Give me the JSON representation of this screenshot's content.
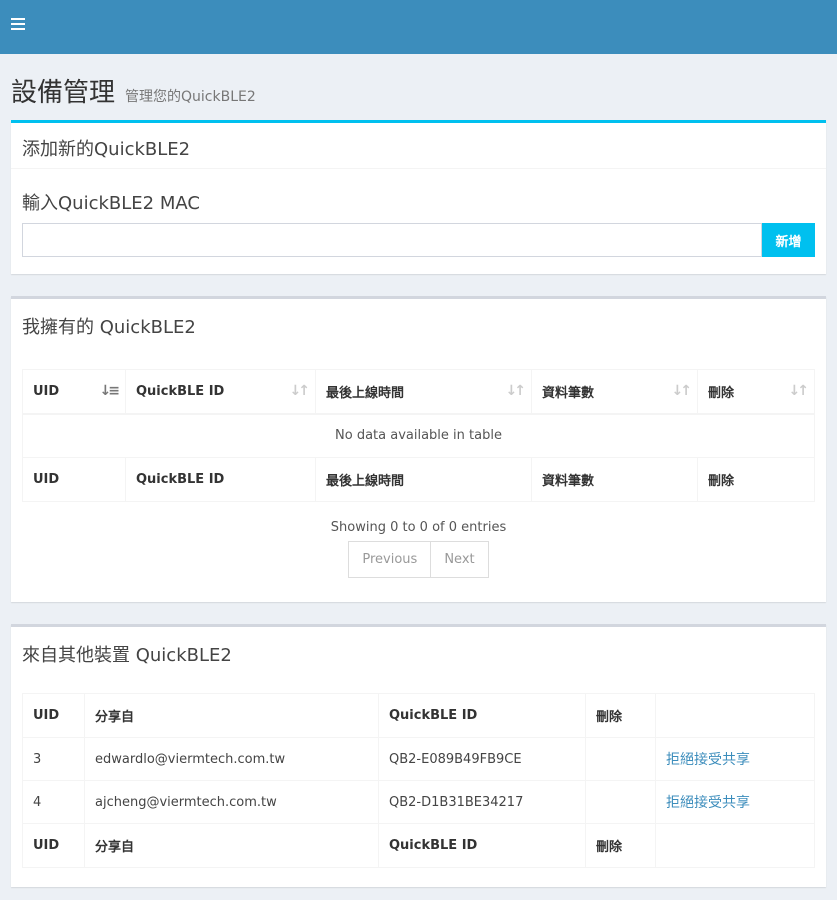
{
  "header": {
    "title": "設備管理",
    "subtitle": "管理您的QuickBLE2"
  },
  "add_box": {
    "title": "添加新的QuickBLE2",
    "label": "輸入QuickBLE2 MAC",
    "input_value": "",
    "button_label": "新增"
  },
  "owned_box": {
    "title": "我擁有的 QuickBLE2",
    "columns": [
      "UID",
      "QuickBLE ID",
      "最後上線時間",
      "資料筆數",
      "刪除"
    ],
    "empty_text": "No data available in table",
    "info_text": "Showing 0 to 0 of 0 entries",
    "pagination": {
      "previous": "Previous",
      "next": "Next"
    }
  },
  "shared_box": {
    "title": "來自其他裝置 QuickBLE2",
    "columns": [
      "UID",
      "分享自",
      "QuickBLE ID",
      "刪除"
    ],
    "rows": [
      {
        "uid": "3",
        "from": "edwardlo@viermtech.com.tw",
        "id": "QB2-E089B49FB9CE",
        "action": "拒絕接受共享"
      },
      {
        "uid": "4",
        "from": "ajcheng@viermtech.com.tw",
        "id": "QB2-D1B31BE34217",
        "action": "拒絕接受共享"
      }
    ]
  },
  "colors": {
    "topbar": "#3c8dbc",
    "accent": "#00c0ef",
    "background": "#ecf0f5"
  },
  "icons": {
    "menu": "hamburger-icon",
    "sort": "sort-icon",
    "sort_asc": "sort-asc-icon"
  }
}
